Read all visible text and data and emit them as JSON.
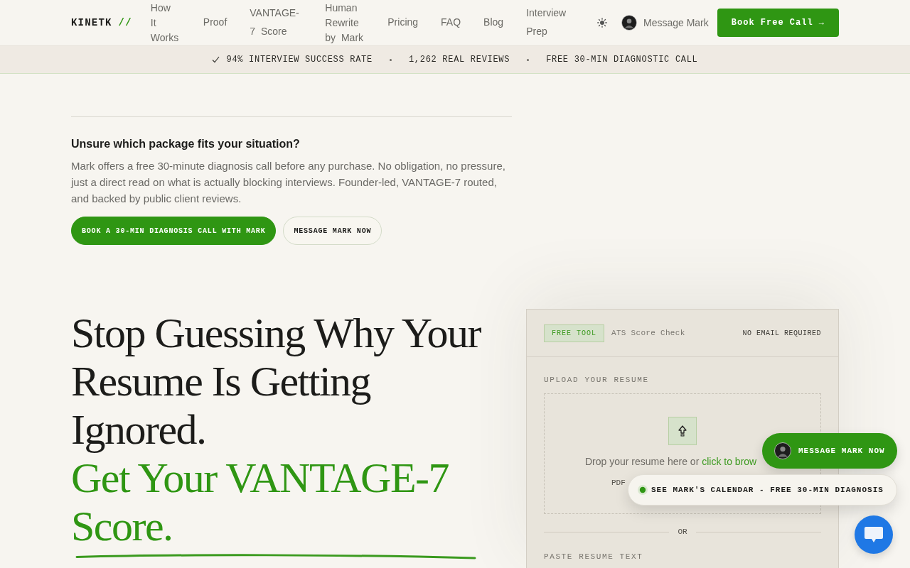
{
  "nav": {
    "logo": {
      "text": "KINETK",
      "mark": "//"
    },
    "links": [
      {
        "label": "How It Works"
      },
      {
        "label": "Proof"
      },
      {
        "label": "VANTAGE-7 Score"
      },
      {
        "label": "Human Rewrite by Mark"
      },
      {
        "label": "Pricing"
      },
      {
        "label": "FAQ"
      },
      {
        "label": "Blog"
      },
      {
        "label": "Interview Prep"
      }
    ],
    "message_link": {
      "label": "Message Mark"
    },
    "cta": {
      "label": "Book Free Call →"
    }
  },
  "trust_bar": [
    {
      "kind": "check",
      "text": "94% INTERVIEW SUCCESS RATE"
    },
    {
      "kind": "plain",
      "text": "1,262 REAL REVIEWS"
    },
    {
      "kind": "plain",
      "text": "FREE 30-MIN DIAGNOSTIC CALL"
    }
  ],
  "help": {
    "title": "Unsure which package fits your situation?",
    "body": "Mark offers a free 30-minute diagnosis call before any purchase. No obligation, no pressure, just a direct read on what is actually blocking interviews. Founder-led, VANTAGE-7 routed, and backed by public client reviews.",
    "buttons": [
      {
        "kind": "primary",
        "label": "BOOK A 30-MIN DIAGNOSIS CALL WITH MARK"
      },
      {
        "kind": "outline",
        "label": "MESSAGE MARK NOW"
      }
    ]
  },
  "hero": {
    "title": "Stop Guessing Why Your Resume Is Getting Ignored.",
    "highlight": "Get Your VANTAGE-7 Score."
  },
  "ats_tool": {
    "badge": "FREE TOOL",
    "title": "ATS Score Check",
    "note": "NO EMAIL REQUIRED",
    "upload_label": "UPLOAD YOUR RESUME",
    "dropzone": {
      "text": "Drop your resume here or",
      "link": "click to brow",
      "formats": "PDF"
    },
    "divider": "OR",
    "paste_label": "PASTE RESUME TEXT"
  },
  "floating": {
    "message_button": {
      "label": "MESSAGE MARK NOW"
    },
    "calendar_button": {
      "label": "SEE MARK'S CALENDAR - FREE 30-MIN DIAGNOSIS"
    }
  }
}
